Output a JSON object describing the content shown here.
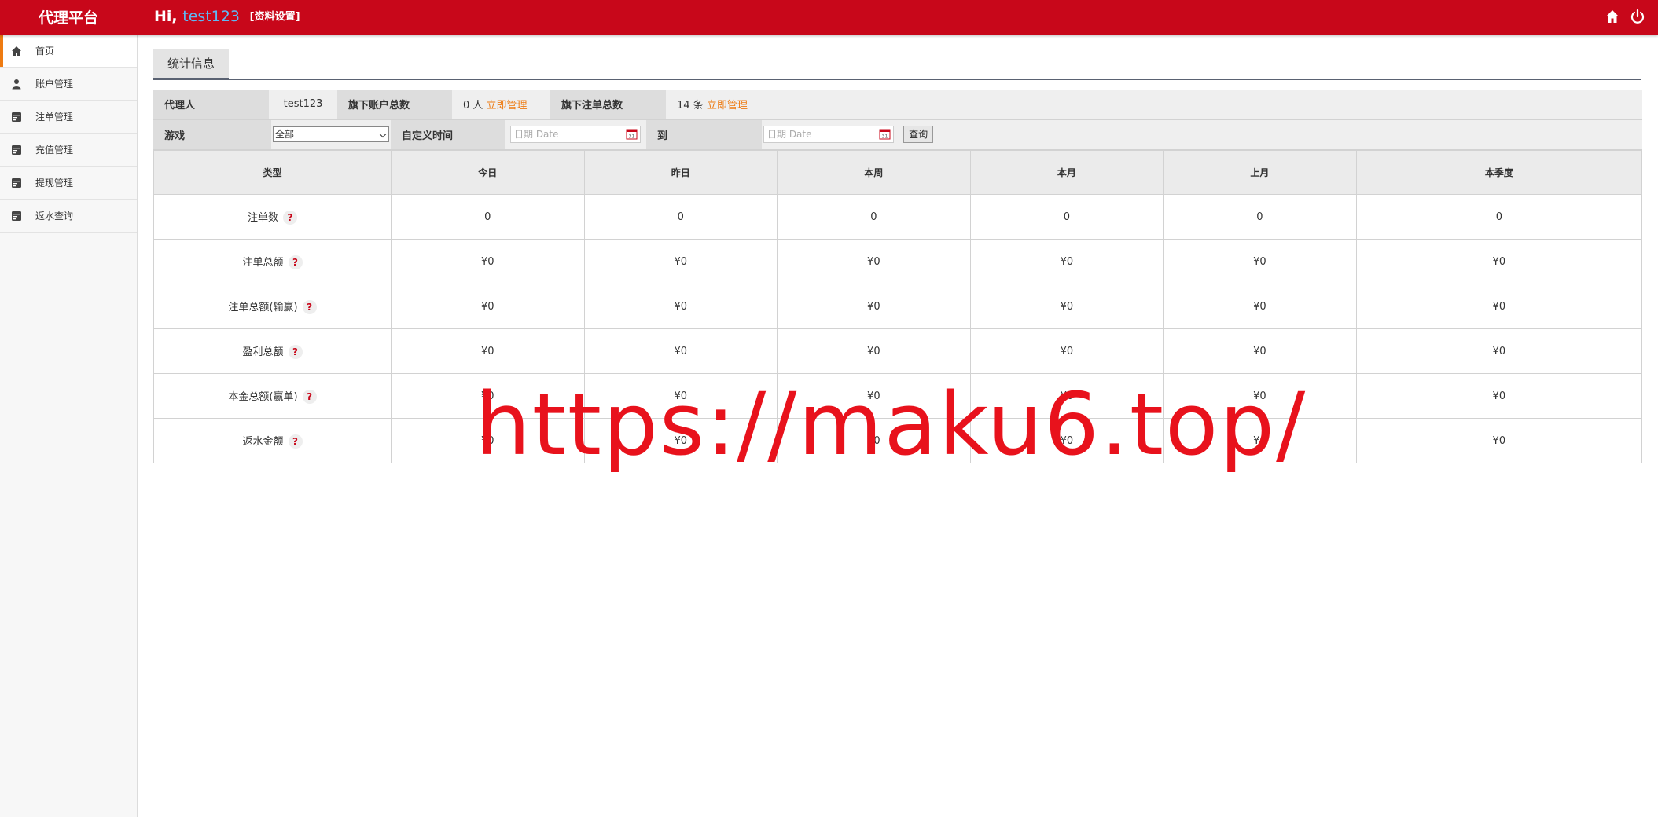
{
  "header": {
    "brand": "代理平台",
    "greeting_prefix": "Hi,",
    "username": "test123",
    "profile_link": "[资料设置]",
    "icons": [
      "home-icon",
      "power-icon"
    ]
  },
  "sidebar": {
    "items": [
      {
        "label": "首页",
        "icon": "home-icon",
        "active": true
      },
      {
        "label": "账户管理",
        "icon": "user-icon",
        "active": false
      },
      {
        "label": "注单管理",
        "icon": "ledger-icon",
        "active": false
      },
      {
        "label": "充值管理",
        "icon": "ledger-icon",
        "active": false
      },
      {
        "label": "提现管理",
        "icon": "ledger-icon",
        "active": false
      },
      {
        "label": "返水查询",
        "icon": "ledger-icon",
        "active": false
      }
    ]
  },
  "main": {
    "tab": "统计信息",
    "info": {
      "agent_label": "代理人",
      "agent_value": "test123",
      "accounts_label": "旗下账户总数",
      "accounts_value": "0 人",
      "accounts_link": "立即管理",
      "orders_label": "旗下注单总数",
      "orders_value": "14 条",
      "orders_link": "立即管理"
    },
    "filter": {
      "game_label": "游戏",
      "game_selected": "全部",
      "custom_time_label": "自定义时间",
      "date_placeholder": "日期 Date",
      "to_label": "到",
      "query_button": "查询"
    },
    "stats": {
      "headers": [
        "类型",
        "今日",
        "昨日",
        "本周",
        "本月",
        "上月",
        "本季度"
      ],
      "rows": [
        {
          "label": "注单数",
          "values": [
            "0",
            "0",
            "0",
            "0",
            "0",
            "0"
          ]
        },
        {
          "label": "注单总额",
          "values": [
            "¥0",
            "¥0",
            "¥0",
            "¥0",
            "¥0",
            "¥0"
          ]
        },
        {
          "label": "注单总额(输赢)",
          "values": [
            "¥0",
            "¥0",
            "¥0",
            "¥0",
            "¥0",
            "¥0"
          ]
        },
        {
          "label": "盈利总额",
          "values": [
            "¥0",
            "¥0",
            "¥0",
            "¥0",
            "¥0",
            "¥0"
          ]
        },
        {
          "label": "本金总额(赢单)",
          "values": [
            "¥0",
            "¥0",
            "¥0",
            "¥0",
            "¥0",
            "¥0"
          ]
        },
        {
          "label": "返水金额",
          "values": [
            "¥0",
            "¥0",
            "¥0",
            "¥0",
            "¥0",
            "¥0"
          ]
        }
      ],
      "help_mark": "?"
    }
  },
  "watermark": "https://maku6.top/",
  "colors": {
    "header_bg": "#c8071a",
    "accent_orange": "#ee7b12",
    "username_blue": "#5fb8f5",
    "watermark_red": "#e8121c"
  }
}
